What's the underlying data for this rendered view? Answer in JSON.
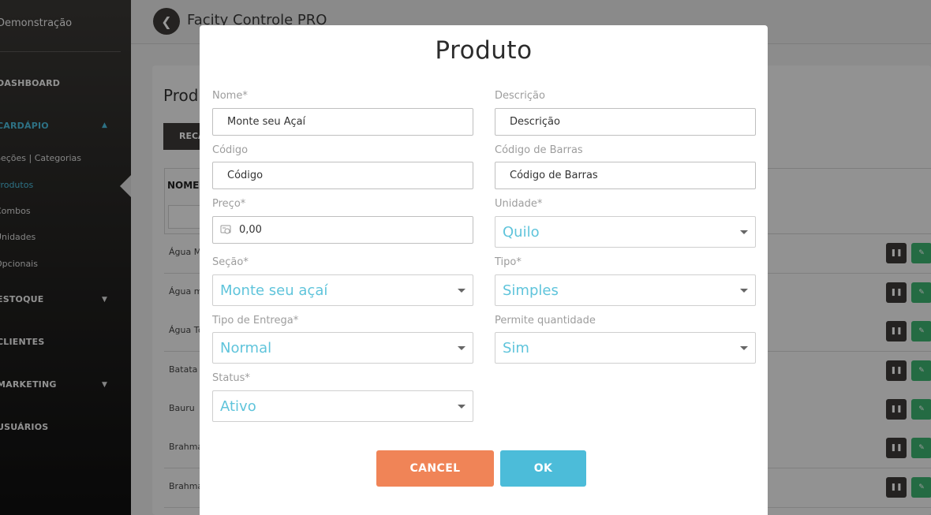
{
  "sidebar": {
    "brand": "Demonstração",
    "items": {
      "dashboard": "DASHBOARD",
      "cardapio": "CARDÁPIO",
      "estoque": "ESTOQUE",
      "clientes": "CLIENTES",
      "marketing": "MARKETING",
      "usuarios": "USUÁRIOS"
    },
    "subitems": {
      "secoes": "Seções | Categorias",
      "produtos": "Produtos",
      "combos": "Combos",
      "unidades": "Unidades",
      "opcionais": "Opcionais"
    },
    "active_color": "#4bbcdc"
  },
  "header": {
    "app_title": "Facity Controle PRO"
  },
  "page": {
    "title": "Produtos",
    "recarregar_label": "RECARREGAR",
    "column_nome": "NOME",
    "rows": [
      "Água Mineral",
      "Água mineral com gás",
      "Água Tônica",
      "Batata frita",
      "Bauru",
      "Brahma",
      "Brahma"
    ]
  },
  "modal": {
    "title": "Produto",
    "fields": {
      "nome": {
        "label": "Nome*",
        "value": "Monte seu Açaí"
      },
      "descricao": {
        "label": "Descrição",
        "placeholder": "Descrição"
      },
      "codigo": {
        "label": "Código",
        "placeholder": "Código"
      },
      "codigo_barras": {
        "label": "Código de Barras",
        "placeholder": "Código de Barras"
      },
      "preco": {
        "label": "Preço*",
        "value": "0,00"
      },
      "unidade": {
        "label": "Unidade*",
        "value": "Quilo"
      },
      "secao": {
        "label": "Seção*",
        "value": "Monte seu açaí"
      },
      "tipo": {
        "label": "Tipo*",
        "value": "Simples"
      },
      "tipo_entrega": {
        "label": "Tipo de Entrega*",
        "value": "Normal"
      },
      "permite_quantidade": {
        "label": "Permite quantidade",
        "value": "Sim"
      },
      "status": {
        "label": "Status*",
        "value": "Ativo"
      }
    },
    "cancel_label": "CANCEL",
    "ok_label": "OK",
    "colors": {
      "cancel": "#f08457",
      "ok": "#4cbcd9",
      "select_text": "#5fc4db"
    }
  }
}
